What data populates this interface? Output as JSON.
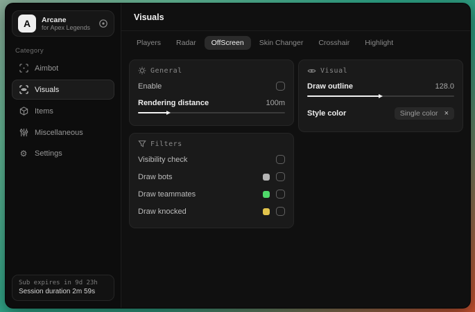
{
  "window": {
    "sidebar": {
      "logo": {
        "initial": "A",
        "title": "Arcane",
        "subtitle": "for Apex Legends"
      },
      "category_label": "Category",
      "items": [
        {
          "label": "Aimbot",
          "icon": "crosshair-scan-icon",
          "active": false
        },
        {
          "label": "Visuals",
          "icon": "eye-scan-icon",
          "active": true
        },
        {
          "label": "Items",
          "icon": "cube-icon",
          "active": false
        },
        {
          "label": "Miscellaneous",
          "icon": "sliders-icon",
          "active": false
        },
        {
          "label": "Settings",
          "icon": "gear-icon",
          "active": false
        }
      ],
      "settings_gear_glyph": "⚙",
      "footer": {
        "sub_expires": "Sub expires in 9d 23h",
        "session_duration": "Session duration 2m 59s"
      }
    },
    "main": {
      "title": "Visuals",
      "tabs": [
        {
          "label": "Players",
          "active": false
        },
        {
          "label": "Radar",
          "active": false
        },
        {
          "label": "OffScreen",
          "active": true
        },
        {
          "label": "Skin Changer",
          "active": false
        },
        {
          "label": "Crosshair",
          "active": false
        },
        {
          "label": "Highlight",
          "active": false
        }
      ],
      "panels": {
        "general": {
          "title": "General",
          "enable_label": "Enable",
          "enable_checked": false,
          "rendering_distance_label": "Rendering distance",
          "rendering_distance_value": "100m",
          "rendering_distance_fill": "20%"
        },
        "visual": {
          "title": "Visual",
          "draw_outline_label": "Draw outline",
          "draw_outline_value": "128.0",
          "draw_outline_fill": "49%",
          "style_color_label": "Style color",
          "style_color_value": "Single color",
          "style_color_clear_glyph": "×"
        },
        "filters": {
          "title": "Filters",
          "rows": [
            {
              "label": "Visibility check",
              "swatch": "",
              "checked": false
            },
            {
              "label": "Draw bots",
              "swatch": "#b5b5b5",
              "checked": false
            },
            {
              "label": "Draw teammates",
              "swatch": "#4fd96a",
              "checked": false
            },
            {
              "label": "Draw knocked",
              "swatch": "#e2c44c",
              "checked": false
            }
          ]
        }
      }
    }
  },
  "colors": {
    "swatch_bots": "#b5b5b5",
    "swatch_teammates": "#4fd96a",
    "swatch_knocked": "#e2c44c",
    "slider_fill": "#f2f2f2",
    "active_tab_bg": "#2b2b2b"
  }
}
